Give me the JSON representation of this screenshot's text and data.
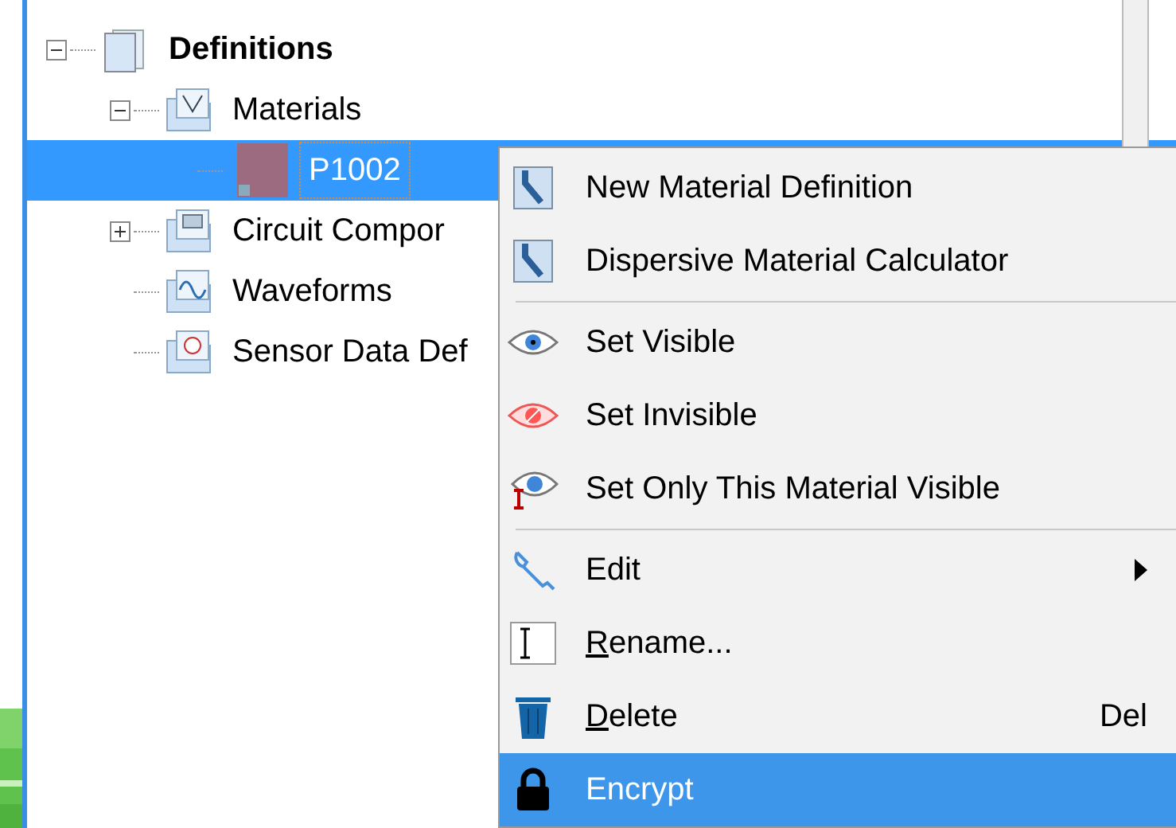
{
  "tree": [
    {
      "label": "Definitions",
      "expanded": true,
      "selected": false,
      "children": [
        {
          "label": "Materials",
          "expanded": true,
          "selected": false,
          "children": [
            {
              "label": "P1002",
              "selected": true,
              "color": "#9c6b80"
            }
          ]
        },
        {
          "label": "Circuit Compor",
          "expanded": false,
          "selected": false
        },
        {
          "label": "Waveforms",
          "selected": false
        },
        {
          "label": "Sensor Data Def",
          "selected": false
        }
      ]
    }
  ],
  "context_menu": [
    {
      "kind": "item",
      "label": "New Material Definition",
      "selected": false
    },
    {
      "kind": "item",
      "label": "Dispersive Material Calculator",
      "selected": false
    },
    {
      "kind": "separator"
    },
    {
      "kind": "item",
      "label": "Set Visible",
      "selected": false
    },
    {
      "kind": "item",
      "label": "Set Invisible",
      "selected": false
    },
    {
      "kind": "item",
      "label": "Set Only This Material Visible",
      "selected": false
    },
    {
      "kind": "separator"
    },
    {
      "kind": "item",
      "label": "Edit",
      "selected": false,
      "submenu": true
    },
    {
      "kind": "item",
      "label": "Rename...",
      "selected": false,
      "access_key_underlined": true
    },
    {
      "kind": "item",
      "label": "Delete",
      "selected": false,
      "access_key_underlined": true,
      "shortcut": "Del"
    },
    {
      "kind": "item",
      "label": "Encrypt",
      "selected": true
    }
  ]
}
